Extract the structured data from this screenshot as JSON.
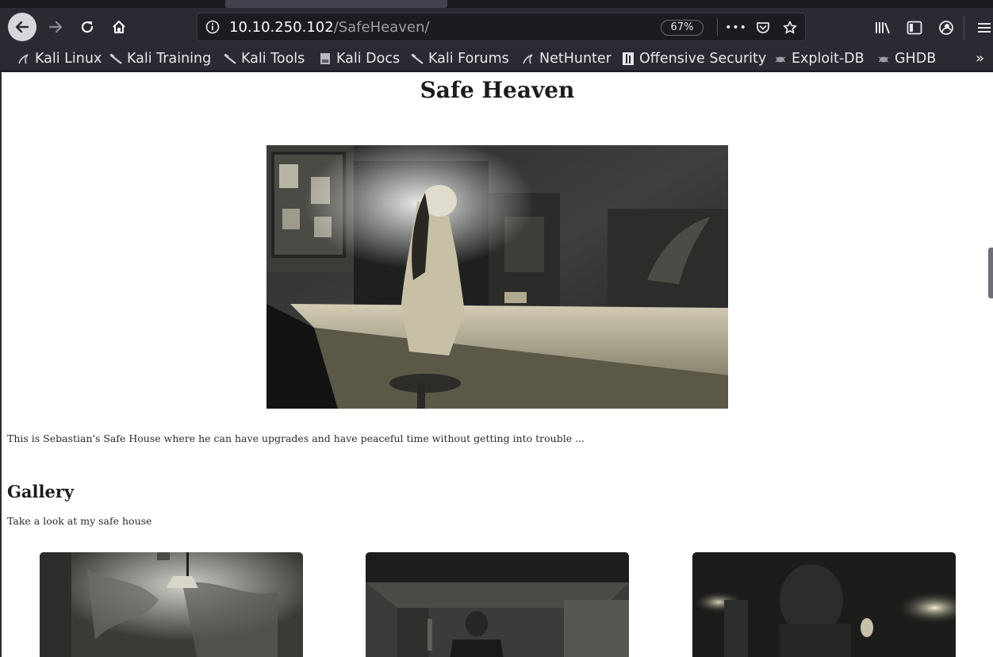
{
  "browser": {
    "url": {
      "host": "10.10.250.102",
      "path": "/SafeHeaven/"
    },
    "zoom_label": "67%",
    "more_label": "•••",
    "bookmarks": [
      {
        "label": "Kali Linux",
        "icon": "kali-dragon-icon"
      },
      {
        "label": "Kali Training",
        "icon": "kali-dragon-icon"
      },
      {
        "label": "Kali Tools",
        "icon": "kali-dragon-icon"
      },
      {
        "label": "Kali Docs",
        "icon": "document-icon"
      },
      {
        "label": "Kali Forums",
        "icon": "kali-dragon-icon"
      },
      {
        "label": "NetHunter",
        "icon": "kali-dragon-icon"
      },
      {
        "label": "Offensive Security",
        "icon": "offsec-icon"
      },
      {
        "label": "Exploit-DB",
        "icon": "spider-icon"
      },
      {
        "label": "GHDB",
        "icon": "spider-icon"
      }
    ],
    "overflow_label": "»"
  },
  "page": {
    "title": "Safe Heaven",
    "intro": "This is Sebastian's Safe House where he can have upgrades and have peaceful time without getting into trouble ...",
    "gallery": {
      "title": "Gallery",
      "subtitle": "Take a look at my safe house"
    }
  },
  "colors": {
    "chrome_bg": "#2b2a33",
    "urlbar_bg": "#1c1b22",
    "page_bg": "#ffffff"
  }
}
